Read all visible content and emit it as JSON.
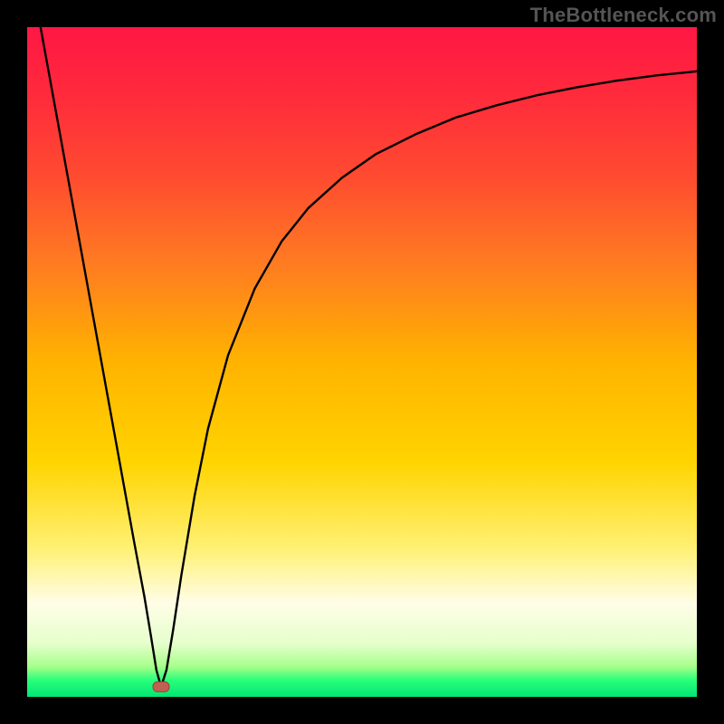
{
  "watermark": "TheBottleneck.com",
  "colors": {
    "black": "#000000",
    "curve": "#000000",
    "marker_fill": "#c06050",
    "marker_stroke": "#9a4438",
    "gradient_stops": [
      {
        "offset": 0.0,
        "color": "#ff1744"
      },
      {
        "offset": 0.1,
        "color": "#ff2a3c"
      },
      {
        "offset": 0.22,
        "color": "#ff4a30"
      },
      {
        "offset": 0.35,
        "color": "#ff7a22"
      },
      {
        "offset": 0.5,
        "color": "#ffb300"
      },
      {
        "offset": 0.65,
        "color": "#ffd400"
      },
      {
        "offset": 0.78,
        "color": "#fff176"
      },
      {
        "offset": 0.86,
        "color": "#fffde7"
      },
      {
        "offset": 0.92,
        "color": "#e6ffcc"
      },
      {
        "offset": 0.955,
        "color": "#a6ff8a"
      },
      {
        "offset": 0.975,
        "color": "#29ff7a"
      },
      {
        "offset": 1.0,
        "color": "#00e676"
      }
    ]
  },
  "chart_data": {
    "type": "line",
    "title": "",
    "xlabel": "",
    "ylabel": "",
    "xlim": [
      0,
      100
    ],
    "ylim": [
      0,
      100
    ],
    "grid": false,
    "legend": false,
    "marker": {
      "x": 20,
      "y": 1.5
    },
    "series": [
      {
        "name": "bottleneck-curve",
        "x": [
          2,
          4,
          6,
          8,
          10,
          12,
          14,
          16,
          17.5,
          18.5,
          19.3,
          20,
          20.8,
          21.8,
          23,
          25,
          27,
          30,
          34,
          38,
          42,
          47,
          52,
          58,
          64,
          70,
          76,
          82,
          88,
          94,
          100
        ],
        "y": [
          100,
          89,
          78,
          67,
          56,
          45,
          34,
          23,
          15,
          9,
          4,
          1.5,
          4,
          10,
          18,
          30,
          40,
          51,
          61,
          68,
          73,
          77.5,
          81,
          84,
          86.5,
          88.3,
          89.8,
          91,
          92,
          92.8,
          93.4
        ]
      }
    ]
  }
}
